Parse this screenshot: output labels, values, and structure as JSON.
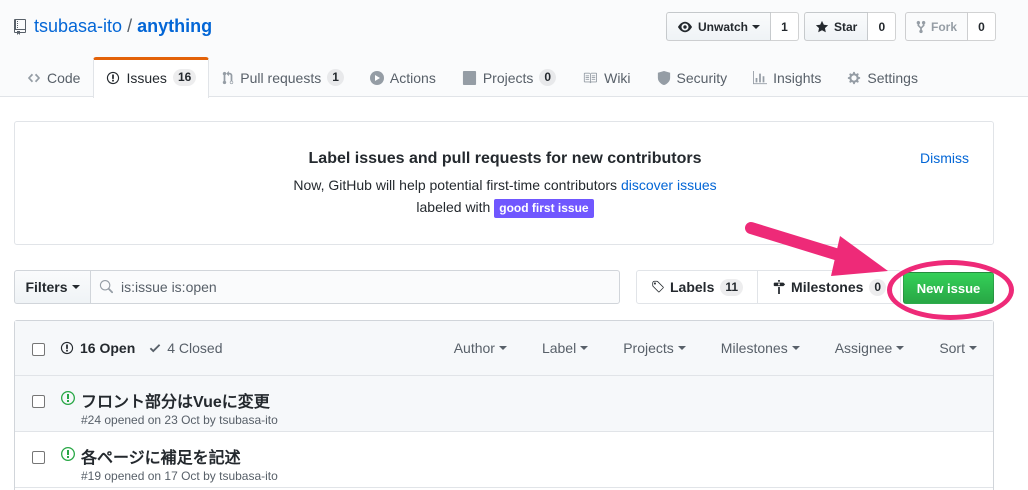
{
  "repo": {
    "owner": "tsubasa-ito",
    "separator": "/",
    "name": "anything"
  },
  "actions": {
    "unwatch": {
      "label": "Unwatch",
      "count": "1"
    },
    "star": {
      "label": "Star",
      "count": "0"
    },
    "fork": {
      "label": "Fork",
      "count": "0"
    }
  },
  "tabs": [
    {
      "label": "Code",
      "icon": "code-icon"
    },
    {
      "label": "Issues",
      "icon": "issue-opened-icon",
      "count": "16",
      "selected": true
    },
    {
      "label": "Pull requests",
      "icon": "pull-request-icon",
      "count": "1"
    },
    {
      "label": "Actions",
      "icon": "play-icon"
    },
    {
      "label": "Projects",
      "icon": "project-icon",
      "count": "0"
    },
    {
      "label": "Wiki",
      "icon": "book-icon"
    },
    {
      "label": "Security",
      "icon": "shield-icon"
    },
    {
      "label": "Insights",
      "icon": "graph-icon"
    },
    {
      "label": "Settings",
      "icon": "gear-icon"
    }
  ],
  "banner": {
    "title": "Label issues and pull requests for new contributors",
    "line1_prefix": "Now, GitHub will help potential first-time contributors",
    "line1_link": "discover issues",
    "line2_prefix": "labeled with",
    "label": "good first issue",
    "label_color": "#7057ff",
    "dismiss": "Dismiss"
  },
  "filter_bar": {
    "filters_label": "Filters",
    "search_value": "is:issue is:open",
    "labels_label": "Labels",
    "labels_count": "11",
    "milestones_label": "Milestones",
    "milestones_count": "0",
    "new_issue_label": "New issue"
  },
  "annotation_color": "#ee2a78",
  "list_header": {
    "open_label": "16 Open",
    "closed_label": "4 Closed",
    "filters": [
      "Author",
      "Label",
      "Projects",
      "Milestones",
      "Assignee",
      "Sort"
    ]
  },
  "issues": [
    {
      "title": "フロント部分はVueに変更",
      "meta": "#24 opened on 23 Oct by tsubasa-ito"
    },
    {
      "title": "各ページに補足を記述",
      "meta": "#19 opened on 17 Oct by tsubasa-ito"
    }
  ]
}
